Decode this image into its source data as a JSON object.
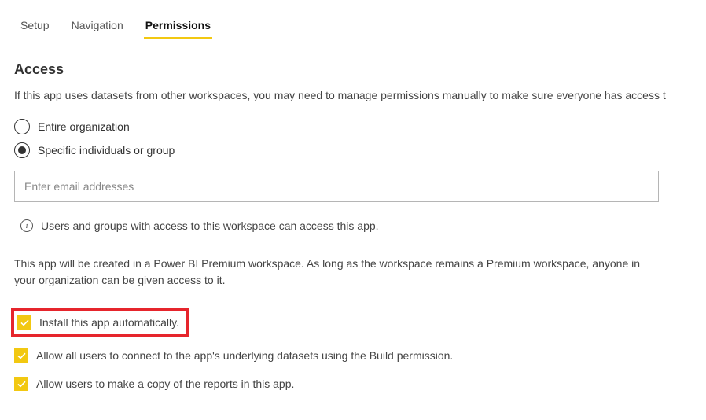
{
  "tabs": {
    "setup": "Setup",
    "navigation": "Navigation",
    "permissions": "Permissions"
  },
  "section": {
    "title": "Access",
    "description": "If this app uses datasets from other workspaces, you may need to manage permissions manually to make sure everyone has access t"
  },
  "radios": {
    "entire_org": "Entire organization",
    "specific": "Specific individuals or group"
  },
  "email": {
    "placeholder": "Enter email addresses"
  },
  "info": {
    "text": "Users and groups with access to this workspace can access this app."
  },
  "premium": {
    "text": "This app will be created in a Power BI Premium workspace. As long as the workspace remains a Premium workspace, anyone in your organization can be given access to it."
  },
  "checkboxes": {
    "install_auto": "Install this app automatically.",
    "allow_connect": "Allow all users to connect to the app's underlying datasets using the Build permission.",
    "allow_copy": "Allow users to make a copy of the reports in this app."
  }
}
